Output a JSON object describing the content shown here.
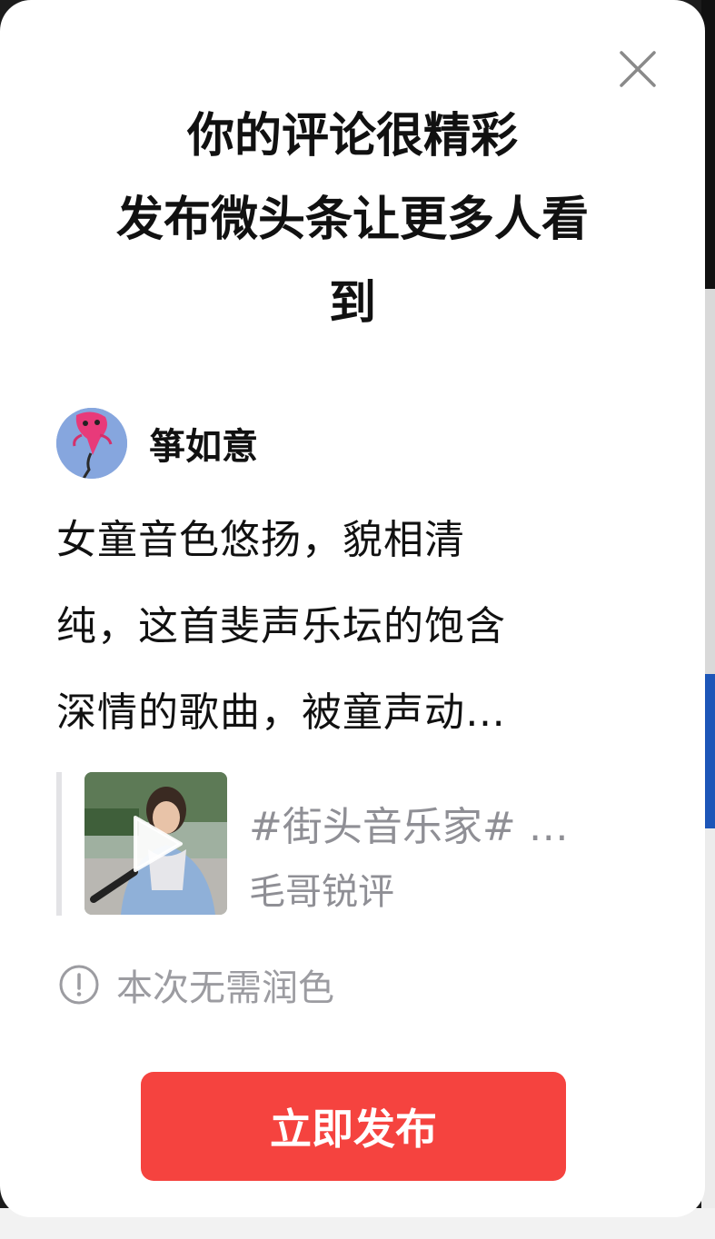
{
  "headline": {
    "line1": "你的评论很精彩",
    "line2": "发布微头条让更多人看",
    "line3": "到"
  },
  "author": {
    "name": "箏如意"
  },
  "comment": {
    "line1": "女童音色悠扬，貌相清",
    "line2": "纯，这首斐声乐坛的饱含",
    "line3": "深情的歌曲，被童声动…"
  },
  "quote_card": {
    "title": "#街头音乐家# …",
    "subtitle": "毛哥锐评"
  },
  "notice": {
    "text": "本次无需润色"
  },
  "publish_button": {
    "label": "立即发布"
  },
  "colors": {
    "accent": "#f5433f",
    "muted_text": "#8f8f95"
  },
  "icons": [
    "close-icon",
    "play-icon",
    "info-icon"
  ]
}
